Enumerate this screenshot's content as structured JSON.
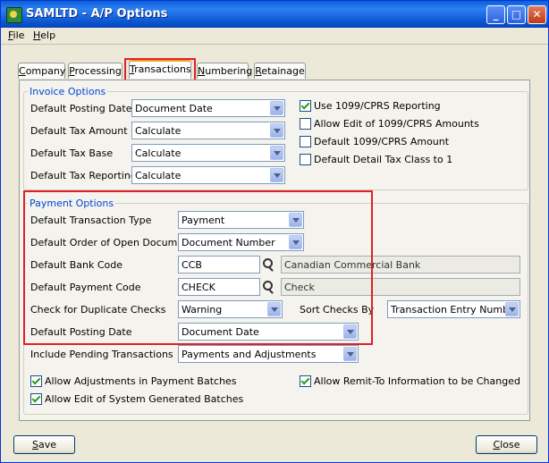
{
  "window": {
    "title": "SAMLTD - A/P Options"
  },
  "menu": [
    {
      "label": "File",
      "key": "F",
      "rest": "ile"
    },
    {
      "label": "Help",
      "key": "H",
      "rest": "elp"
    }
  ],
  "tabs": [
    {
      "label": "Company",
      "key": "C",
      "rest": "ompany"
    },
    {
      "label": "Processing",
      "key": "P",
      "rest": "rocessing"
    },
    {
      "label": "Transactions",
      "key": "T",
      "rest": "ransactions"
    },
    {
      "label": "Numbering",
      "key": "N",
      "rest": "umbering"
    },
    {
      "label": "Retainage",
      "key": "R",
      "rest": "etainage"
    }
  ],
  "active_tab": "Transactions",
  "invoice_options": {
    "title": "Invoice Options",
    "fields": [
      {
        "label": "Default Posting Date",
        "value": "Document Date"
      },
      {
        "label": "Default Tax Amount",
        "value": "Calculate"
      },
      {
        "label": "Default Tax Base",
        "value": "Calculate"
      },
      {
        "label": "Default Tax Reporting",
        "value": "Calculate"
      }
    ],
    "checks": [
      {
        "label": "Use 1099/CPRS Reporting",
        "checked": true
      },
      {
        "label": "Allow Edit of 1099/CPRS Amounts",
        "checked": false
      },
      {
        "label": "Default 1099/CPRS Amount",
        "checked": false
      },
      {
        "label": "Default Detail Tax Class to 1",
        "checked": false
      }
    ]
  },
  "payment_options": {
    "title": "Payment Options",
    "transaction_type": {
      "label": "Default Transaction Type",
      "value": "Payment"
    },
    "order_open_docs": {
      "label": "Default Order of Open Documents",
      "value": "Document Number"
    },
    "bank_code": {
      "label": "Default Bank Code",
      "value": "CCB",
      "description": "Canadian Commercial Bank"
    },
    "payment_code": {
      "label": "Default Payment Code",
      "value": "CHECK",
      "description": "Check"
    },
    "duplicate_checks": {
      "label": "Check for Duplicate Checks",
      "value": "Warning"
    },
    "sort_checks": {
      "label": "Sort Checks By",
      "value": "Transaction Entry Number"
    },
    "posting_date": {
      "label": "Default Posting Date",
      "value": "Document Date"
    },
    "include_pending": {
      "label": "Include Pending Transactions",
      "value": "Payments and Adjustments"
    },
    "checks": [
      {
        "label": "Allow Adjustments in Payment Batches",
        "checked": true
      },
      {
        "label": "Allow Edit of System Generated Batches",
        "checked": true
      },
      {
        "label": "Allow Remit-To Information to be Changed",
        "checked": true
      }
    ]
  },
  "buttons": {
    "save": {
      "label": "Save",
      "key": "S",
      "rest": "ave"
    },
    "close": {
      "label": "Close",
      "key": "C",
      "rest": "lose"
    }
  },
  "colors": {
    "highlight": "#e0202a",
    "group_title": "#0046d5",
    "titlebar": "#0a5fd8"
  }
}
